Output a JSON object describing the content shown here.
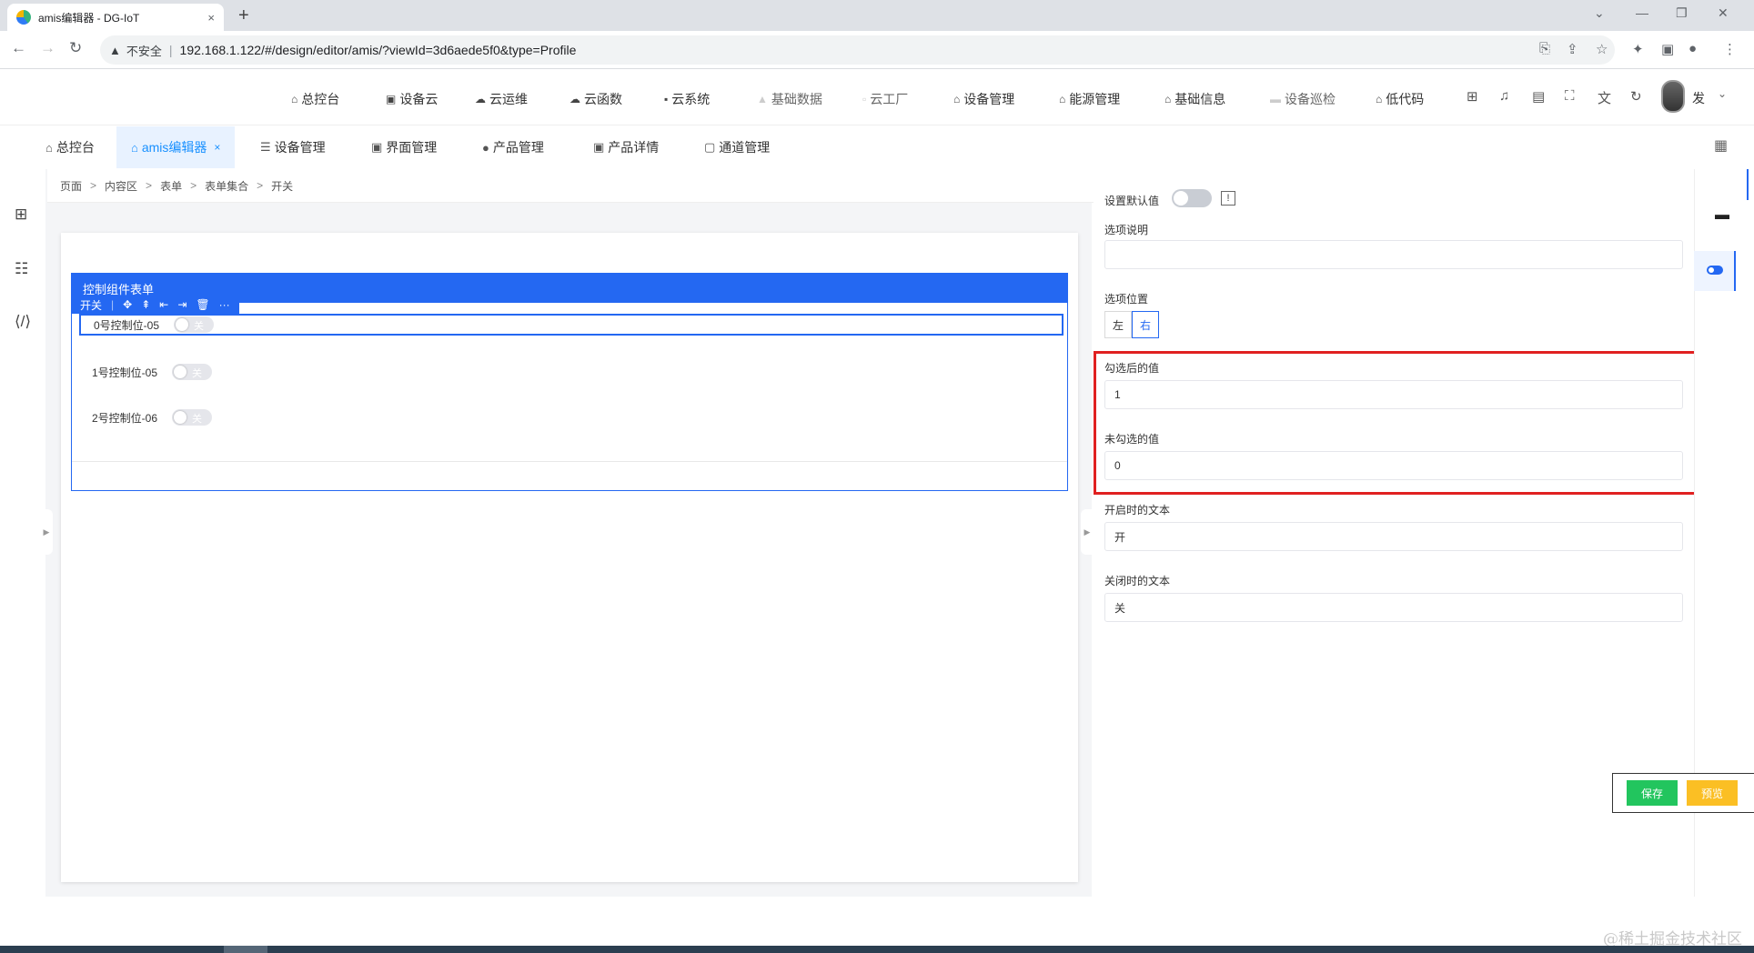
{
  "browser": {
    "tab_title": "amis编辑器 - DG-IoT",
    "tab_close": "×",
    "new_tab": "+",
    "security_label": "不安全",
    "url": "192.168.1.122/#/design/editor/amis/?viewId=3d6aede5f0&type=Profile"
  },
  "topnav": {
    "items": [
      {
        "label": "总控台",
        "icon": "home-icon"
      },
      {
        "label": "设备云",
        "icon": "device-cloud-icon"
      },
      {
        "label": "云运维",
        "icon": "cloud-icon"
      },
      {
        "label": "云函数",
        "icon": "cloud-outline-icon"
      },
      {
        "label": "云系统",
        "icon": "system-icon"
      },
      {
        "label": "基础数据",
        "icon": "data-icon"
      },
      {
        "label": "云工厂",
        "icon": "factory-icon"
      },
      {
        "label": "设备管理",
        "icon": "building-icon"
      },
      {
        "label": "能源管理",
        "icon": "building-icon"
      },
      {
        "label": "基础信息",
        "icon": "building-icon"
      },
      {
        "label": "设备巡检",
        "icon": "inspection-icon"
      },
      {
        "label": "低代码",
        "icon": "building-icon"
      }
    ],
    "user_name": "发"
  },
  "pagetabs": [
    {
      "label": "总控台",
      "icon": "home-icon"
    },
    {
      "label": "amis编辑器",
      "icon": "building-icon",
      "active": true
    },
    {
      "label": "设备管理",
      "icon": "list-icon"
    },
    {
      "label": "界面管理",
      "icon": "code-icon"
    },
    {
      "label": "产品管理",
      "icon": "product-icon"
    },
    {
      "label": "产品详情",
      "icon": "code-icon"
    },
    {
      "label": "通道管理",
      "icon": "chart-icon"
    }
  ],
  "breadcrumb": [
    "页面",
    "内容区",
    "表单",
    "表单集合",
    "开关"
  ],
  "form": {
    "title": "控制组件表单",
    "toolbar_label": "开关",
    "rows": [
      {
        "label": "0号控制位-05",
        "switch_text": "关"
      },
      {
        "label": "1号控制位-05",
        "switch_text": "关"
      },
      {
        "label": "2号控制位-06",
        "switch_text": "关"
      }
    ]
  },
  "props": {
    "default_label": "设置默认值",
    "desc_label": "选项说明",
    "desc_value": "",
    "position_label": "选项位置",
    "position_options": [
      "左",
      "右"
    ],
    "position_selected": "右",
    "checked_label": "勾选后的值",
    "checked_value": "1",
    "unchecked_label": "未勾选的值",
    "unchecked_value": "0",
    "on_text_label": "开启时的文本",
    "on_text_value": "开",
    "off_text_label": "关闭时的文本",
    "off_text_value": "关"
  },
  "actions": {
    "save": "保存",
    "preview": "预览"
  },
  "watermark": "@稀土掘金技术社区",
  "colors": {
    "primary": "#2468f2",
    "highlight": "#e02020",
    "save": "#22c55e",
    "preview": "#fbbf24"
  }
}
